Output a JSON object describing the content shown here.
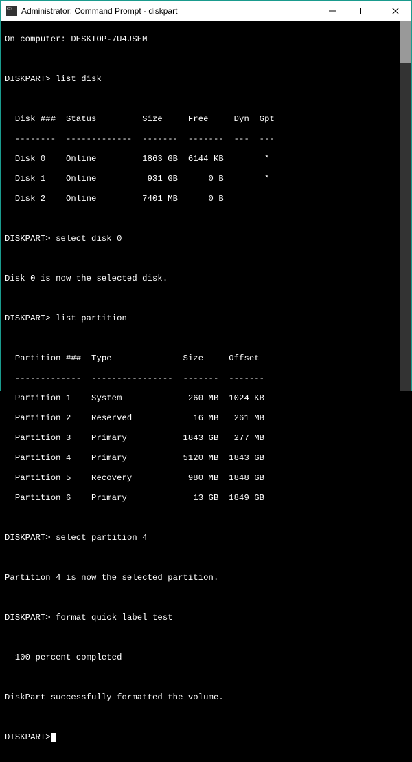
{
  "window": {
    "title": "Administrator: Command Prompt - diskpart"
  },
  "terminal": {
    "computer_line_prefix": "On computer: ",
    "computer_name": "DESKTOP-7U4JSEM",
    "prompt": "DISKPART>",
    "cmd_list_disk": " list disk",
    "disk_header": "  Disk ###  Status         Size     Free     Dyn  Gpt",
    "disk_divider": "  --------  -------------  -------  -------  ---  ---",
    "disks": [
      "  Disk 0    Online         1863 GB  6144 KB        *",
      "  Disk 1    Online          931 GB      0 B        *",
      "  Disk 2    Online         7401 MB      0 B"
    ],
    "cmd_select_disk": " select disk 0",
    "disk_selected_msg": "Disk 0 is now the selected disk.",
    "cmd_list_partition": " list partition",
    "part_header": "  Partition ###  Type              Size     Offset",
    "part_divider": "  -------------  ----------------  -------  -------",
    "partitions": [
      "  Partition 1    System             260 MB  1024 KB",
      "  Partition 2    Reserved            16 MB   261 MB",
      "  Partition 3    Primary           1843 GB   277 MB",
      "  Partition 4    Primary           5120 MB  1843 GB",
      "  Partition 5    Recovery           980 MB  1848 GB",
      "  Partition 6    Primary             13 GB  1849 GB"
    ],
    "cmd_select_partition": " select partition 4",
    "part_selected_msg": "Partition 4 is now the selected partition.",
    "cmd_format": " format quick label=test",
    "progress_msg": "  100 percent completed",
    "success_msg": "DiskPart successfully formatted the volume."
  }
}
